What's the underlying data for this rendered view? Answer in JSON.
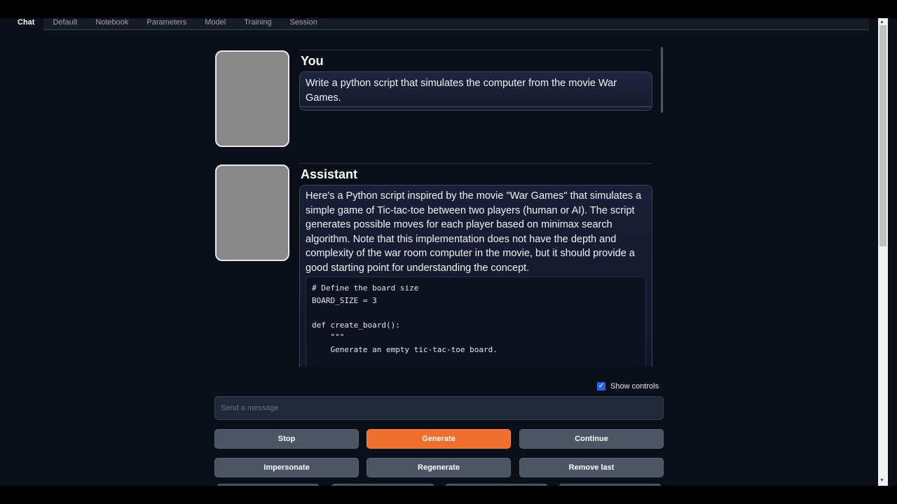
{
  "tabs": [
    "Chat",
    "Default",
    "Notebook",
    "Parameters",
    "Model",
    "Training",
    "Session"
  ],
  "active_tab": "Chat",
  "messages": {
    "user": {
      "name": "You",
      "text": "Write a python script that simulates the computer from the movie War Games."
    },
    "assistant": {
      "name": "Assistant",
      "text": "Here's a Python script inspired by the movie \"War Games\" that simulates a simple game of Tic-tac-toe between two players (human or AI). The script generates possible moves for each player based on minimax search algorithm. Note that this implementation does not have the depth and complexity of the war room computer in the movie, but it should provide a good starting point for understanding the concept.",
      "code_lines": [
        "# Define the board size",
        "BOARD_SIZE = 3",
        "",
        "def create_board():",
        "    \"\"\"",
        "    Generate an empty tic-tac-toe board.",
        ""
      ]
    }
  },
  "show_controls": {
    "label": "Show controls",
    "checked": true
  },
  "input": {
    "placeholder": "Send a message",
    "value": ""
  },
  "buttons": {
    "stop": "Stop",
    "generate": "Generate",
    "continue": "Continue",
    "impersonate": "Impersonate",
    "regenerate": "Regenerate",
    "remove_last": "Remove last"
  },
  "colors": {
    "background": "#0b0f19",
    "primary_button": "#f06f2c",
    "secondary_button": "#4b5563",
    "checkbox": "#2563eb"
  }
}
